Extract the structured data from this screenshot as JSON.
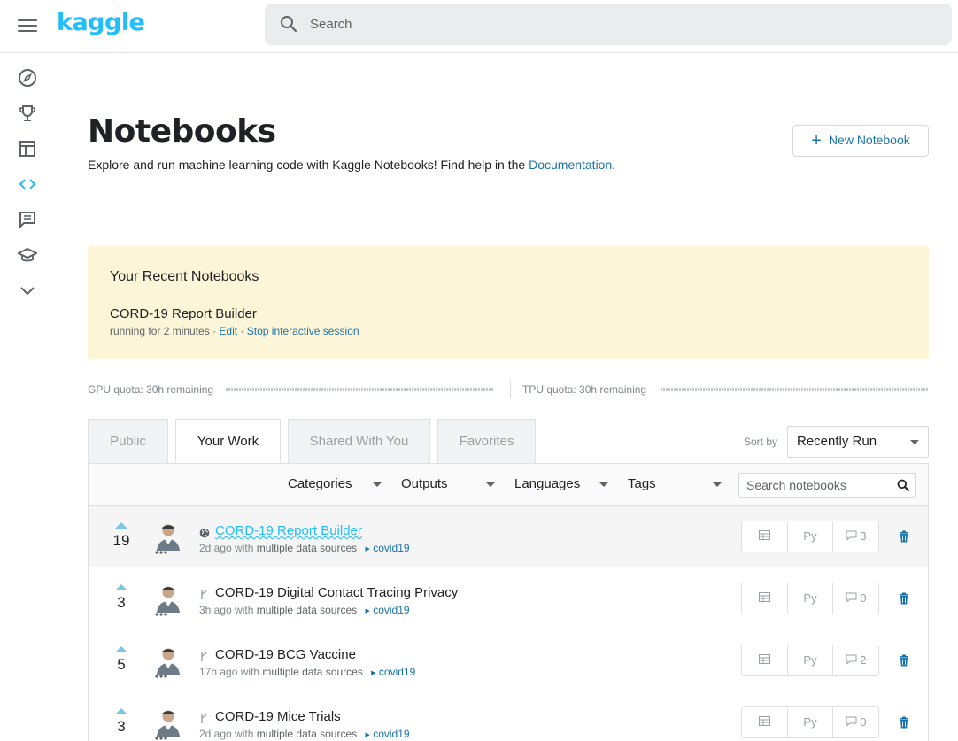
{
  "topbar": {
    "logo": "kaggle",
    "search_placeholder": "Search"
  },
  "sidebar": {
    "items": [
      {
        "icon": "compass-icon",
        "label": "Home"
      },
      {
        "icon": "trophy-icon",
        "label": "Competitions"
      },
      {
        "icon": "table-icon",
        "label": "Datasets"
      },
      {
        "icon": "code-icon",
        "label": "Notebooks",
        "active": true
      },
      {
        "icon": "comments-icon",
        "label": "Discussion"
      },
      {
        "icon": "school-icon",
        "label": "Courses"
      },
      {
        "icon": "chevron-down-icon",
        "label": "More"
      }
    ]
  },
  "header": {
    "title": "Notebooks",
    "subtitle_text": "Explore and run machine learning code with Kaggle Notebooks! Find help in the ",
    "subtitle_link": "Documentation",
    "subtitle_end": ".",
    "new_button_label": "New Notebook"
  },
  "recent": {
    "title": "Your Recent Notebooks",
    "notebook": "CORD-19 Report Builder",
    "status": "running for 2 minutes",
    "edit_label": "Edit",
    "stop_label": "Stop interactive session",
    "separator": " · "
  },
  "quota": {
    "gpu_label": "GPU quota: 30h remaining",
    "gpu_used": 0.0,
    "tpu_label": "TPU quota: 30h remaining",
    "tpu_used": 0.0
  },
  "tabs": [
    "Public",
    "Your Work",
    "Shared With You",
    "Favorites"
  ],
  "active_tab": "Your Work",
  "sort": {
    "label": "Sort by",
    "value": "Recently Run"
  },
  "filters": [
    "Categories",
    "Outputs",
    "Languages",
    "Tags"
  ],
  "nb_search_placeholder": "Search notebooks",
  "notebooks": [
    {
      "votes": "19",
      "title": "CORD-19 Report Builder",
      "age": "2d ago",
      "with": "with",
      "sources": "multiple data sources",
      "tag": "covid19",
      "lang": "Py",
      "comments": "3",
      "private": false
    },
    {
      "votes": "3",
      "title": "CORD-19 Digital Contact Tracing Privacy",
      "age": "3h ago",
      "with": "with",
      "sources": "multiple data sources",
      "tag": "covid19",
      "lang": "Py",
      "comments": "0",
      "private": true
    },
    {
      "votes": "5",
      "title": "CORD-19 BCG Vaccine",
      "age": "17h ago",
      "with": "with",
      "sources": "multiple data sources",
      "tag": "covid19",
      "lang": "Py",
      "comments": "2",
      "private": true
    },
    {
      "votes": "3",
      "title": "CORD-19 Mice Trials",
      "age": "2d ago",
      "with": "with",
      "sources": "multiple data sources",
      "tag": "covid19",
      "lang": "Py",
      "comments": "0",
      "private": true
    }
  ],
  "colors": {
    "brand": "#20beff",
    "link": "#1a73a8",
    "recent_bg": "#fdf5d8"
  }
}
